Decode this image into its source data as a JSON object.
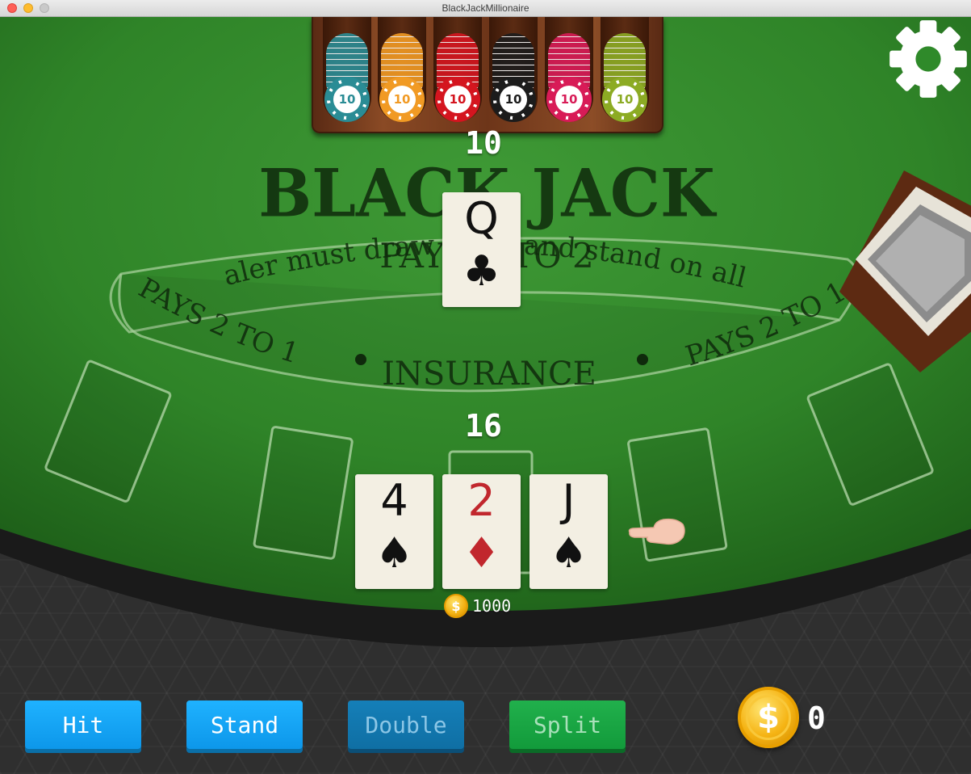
{
  "window": {
    "title": "BlackJackMillionaire"
  },
  "chips": [
    {
      "value": "10",
      "color": "#2a8c95"
    },
    {
      "value": "10",
      "color": "#f19a24"
    },
    {
      "value": "10",
      "color": "#d4151f"
    },
    {
      "value": "10",
      "color": "#1c1c1c"
    },
    {
      "value": "10",
      "color": "#d81b57"
    },
    {
      "value": "10",
      "color": "#8cab24"
    }
  ],
  "table": {
    "title": "BLACK JACK",
    "pays": "PAYS 3 TO 2",
    "rule": "dealer must draw to 16 and stand on all 17s",
    "insurance": "INSURANCE",
    "insurance_left": "PAYS 2 TO 1",
    "insurance_right": "PAYS 2 TO 1"
  },
  "dealer": {
    "score": "10",
    "cards": [
      {
        "rank": "Q",
        "suit": "♣",
        "color": "black"
      }
    ]
  },
  "player": {
    "score": "16",
    "cards": [
      {
        "rank": "4",
        "suit": "♠",
        "color": "black"
      },
      {
        "rank": "2",
        "suit": "♦",
        "color": "red"
      },
      {
        "rank": "J",
        "suit": "♠",
        "color": "black"
      }
    ],
    "bet": "1000",
    "bet_icon": "$"
  },
  "actions": {
    "hit": "Hit",
    "stand": "Stand",
    "double": "Double",
    "split": "Split"
  },
  "wallet": {
    "icon": "$",
    "balance": "0"
  }
}
